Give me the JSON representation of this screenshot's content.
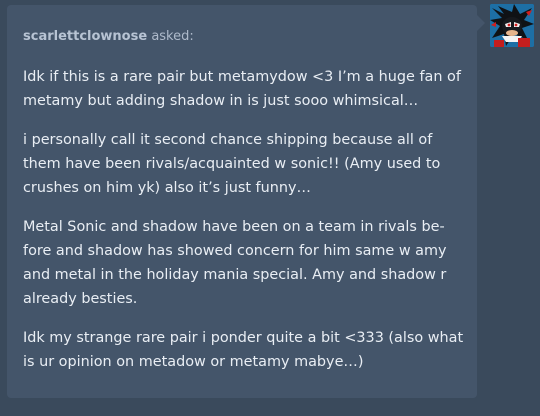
{
  "ask": {
    "asker": "scarlettclownose",
    "asked_label": " asked:",
    "paragraphs": [
      "Idk if this is a rare pair but metamydow <3 I’m a huge fan of metamy but adding shadow in is just sooo whimsical…",
      "i personally call it second chance shipping because all of them have been rivals/acquainted w sonic!! (Amy used to crushes on him yk) also it’s just funny…",
      "Metal Sonic and shadow have been on a team in rivals be­fore and shadow has showed concern for him same w amy and metal in the holiday mania special. Amy and shadow r already besties.",
      "Idk my strange rare pair i ponder quite a bit <333 (also what is ur opinion on metadow or metamy mabye…)"
    ]
  },
  "colors": {
    "page_background": "#3a4a5c",
    "card_background": "#44556a",
    "body_text": "#e9eef4",
    "header_text": "#aebacb"
  },
  "avatar": {
    "icon": "shadow-hedgehog-avatar-icon"
  }
}
